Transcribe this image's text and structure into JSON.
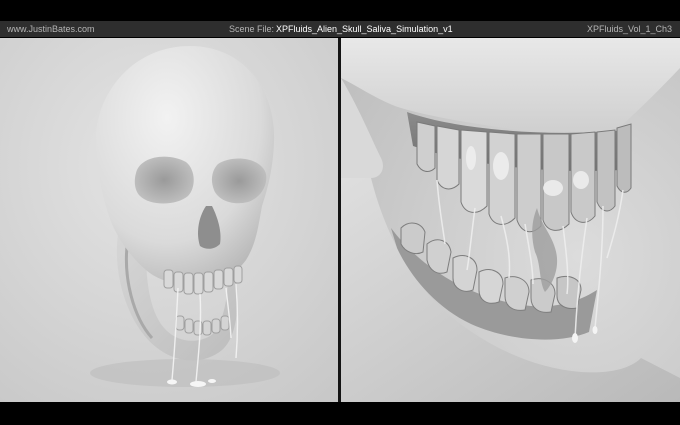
{
  "info_bar": {
    "site": "www.JustinBates.com",
    "scene_label": "Scene File:",
    "scene_file": "XPFluids_Alien_Skull_Saliva_Simulation_v1",
    "volume": "XPFluids_Vol_1_Ch3"
  },
  "views": [
    {
      "name": "front three-quarter view of skull with open jaw"
    },
    {
      "name": "close-up of upper and lower teeth with saliva strands"
    }
  ],
  "colors": {
    "background": "#000000",
    "info_bar": "#2e2e2e",
    "info_text": "#b5b5b5",
    "scene_text": "#ffffff",
    "studio_floor": "#d4d4d4",
    "bone": "#e2e2e2"
  }
}
